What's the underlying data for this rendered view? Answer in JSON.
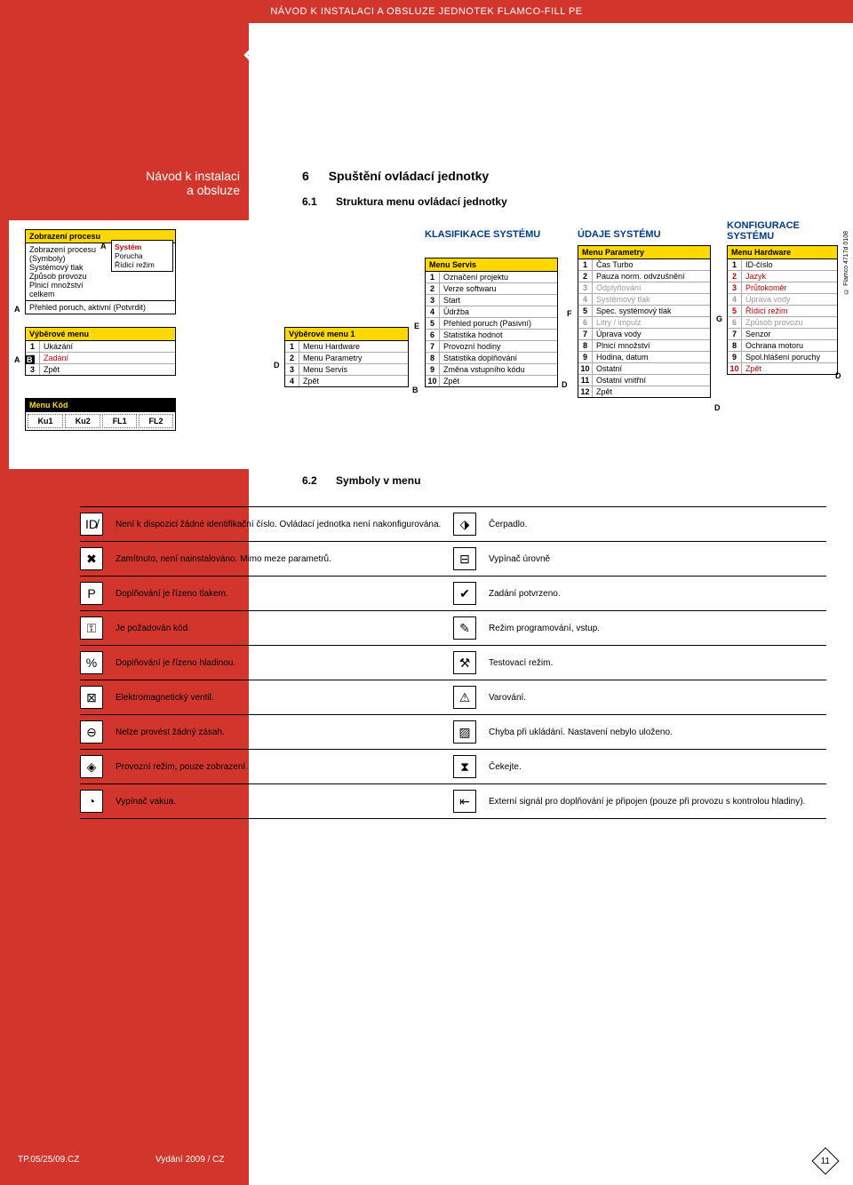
{
  "header": {
    "topbar": "NÁVOD K INSTALACI A OBSLUZE JEDNOTEK FLAMCO-FILL PE",
    "brand": "Flamco"
  },
  "nav": {
    "line1": "Návod k instalaci",
    "line2": "a obsluze"
  },
  "section6": {
    "num": "6",
    "title": "Spuštění ovládací jednotky"
  },
  "section61": {
    "num": "6.1",
    "title": "Struktura menu ovládací jednotky"
  },
  "section62": {
    "num": "6.2",
    "title": "Symboly v menu"
  },
  "diagram": {
    "zobrazeni": {
      "title": "Zobrazení procesu",
      "lines": [
        "Zobrazení procesu",
        "(Symboly)",
        "Systémový tlak",
        "Způsob provozu",
        "Plnicí množství",
        "celkem"
      ],
      "alert": "Přehled poruch, aktivní (Potvrdit)",
      "sysbox_a": "A",
      "sysbox_title": "Systém",
      "sysbox_l1": "Porucha",
      "sysbox_l2": "Řídicí režim"
    },
    "vyber_main": {
      "title": "Výběrové menu",
      "items": [
        {
          "n": "1",
          "t": "Ukázání"
        },
        {
          "n": "2",
          "t": "Zadání",
          "cls": "red"
        },
        {
          "n": "3",
          "t": "Zpět"
        }
      ],
      "tagA": "A",
      "tagB": "B"
    },
    "vyber_1": {
      "title": "Výběrové menu 1",
      "items": [
        {
          "n": "1",
          "t": "Menu Hardware"
        },
        {
          "n": "2",
          "t": "Menu Parametry"
        },
        {
          "n": "3",
          "t": "Menu Servis"
        },
        {
          "n": "4",
          "t": "Zpět"
        }
      ],
      "tagD": "D",
      "tagB": "B"
    },
    "kod": {
      "title": "Menu Kód",
      "cells": [
        "Ku1",
        "Ku2",
        "FL1",
        "FL2"
      ]
    },
    "klas_label": "KLASIFIKACE SYSTÉMU",
    "servis": {
      "title": "Menu Servis",
      "items": [
        {
          "n": "1",
          "t": "Označení projektu"
        },
        {
          "n": "2",
          "t": "Verze softwaru"
        },
        {
          "n": "3",
          "t": "Start"
        },
        {
          "n": "4",
          "t": "Údržba"
        },
        {
          "n": "5",
          "t": "Přehled poruch (Pasivní)"
        },
        {
          "n": "6",
          "t": "Statistika hodnot"
        },
        {
          "n": "7",
          "t": "Provozní hodiny"
        },
        {
          "n": "8",
          "t": "Statistika doplňování"
        },
        {
          "n": "9",
          "t": "Změna vstupního kódu"
        },
        {
          "n": "10",
          "t": "Zpět"
        }
      ],
      "tagE": "E",
      "tagD": "D"
    },
    "udaje_label": "ÚDAJE SYSTÉMU",
    "param": {
      "title": "Menu Parametry",
      "items": [
        {
          "n": "1",
          "t": "Čas Turbo"
        },
        {
          "n": "2",
          "t": "Pauza norm. odvzušnění"
        },
        {
          "n": "3",
          "t": "Odplyňování",
          "cls": "gray"
        },
        {
          "n": "4",
          "t": "Systémový tlak",
          "cls": "gray"
        },
        {
          "n": "5",
          "t": "Spec. systémový tlak"
        },
        {
          "n": "6",
          "t": "Litry / impulz",
          "cls": "gray"
        },
        {
          "n": "7",
          "t": "Úprava vody"
        },
        {
          "n": "8",
          "t": "Plnicí množství"
        },
        {
          "n": "9",
          "t": "Hodina, datum"
        },
        {
          "n": "10",
          "t": "Ostatní"
        },
        {
          "n": "11",
          "t": "Ostatní vnitřní"
        },
        {
          "n": "12",
          "t": "Zpět"
        }
      ],
      "tagF": "F",
      "tagD": "D"
    },
    "konf_label": "KONFIGURACE SYSTÉMU",
    "hardware": {
      "title": "Menu Hardware",
      "items": [
        {
          "n": "1",
          "t": "ID-číslo"
        },
        {
          "n": "2",
          "t": "Jazyk",
          "cls": "red"
        },
        {
          "n": "3",
          "t": "Průtokoměr",
          "cls": "red"
        },
        {
          "n": "4",
          "t": "Úprava vody",
          "cls": "gray"
        },
        {
          "n": "5",
          "t": "Řídicí režim",
          "cls": "red"
        },
        {
          "n": "6",
          "t": "Způsob provozu",
          "cls": "gray"
        },
        {
          "n": "7",
          "t": "Senzor"
        },
        {
          "n": "8",
          "t": "Ochrana motoru"
        },
        {
          "n": "9",
          "t": "Spol.hlášení poruchy"
        },
        {
          "n": "10",
          "t": "Zpět",
          "cls": "red"
        }
      ],
      "tagG": "G",
      "tagD": "D"
    }
  },
  "legend": [
    {
      "li": "ID̸",
      "lt": "Není k dispozici žádné identifikační číslo. Ovládací jednotka není nakonfigurována.",
      "ri": "⬗",
      "rt": "Čerpadlo."
    },
    {
      "li": "✖",
      "lt": "Zamítnuto, není nainstalováno. Mimo meze parametrů.",
      "ri": "⊟",
      "rt": "Vypínač úrovně"
    },
    {
      "li": "P",
      "lt": "Doplňování je řízeno tlakem.",
      "ri": "✔",
      "rt": "Zadání potvrzeno."
    },
    {
      "li": "⚿",
      "lt": "Je požadován kód.",
      "ri": "✎",
      "rt": "Režim programování, vstup."
    },
    {
      "li": "%",
      "lt": "Doplňování je řízeno hladinou.",
      "ri": "⚒",
      "rt": "Testovací režim."
    },
    {
      "li": "⊠",
      "lt": "Elektromagnetický ventil.",
      "ri": "⚠",
      "rt": "Varování."
    },
    {
      "li": "⊖",
      "lt": "Nelze provést žádný zásah.",
      "ri": "▨",
      "rt": "Chyba při ukládání. Nastavení nebylo uloženo."
    },
    {
      "li": "◈",
      "lt": "Provozní režim, pouze zobrazení.",
      "ri": "⧗",
      "rt": "Čekejte."
    },
    {
      "li": "◔",
      "lt": "Vypínač vakua.",
      "ri": "⇤",
      "rt": "Externí signál pro doplňování je připojen (pouze při provozu s kontrolou hladiny)."
    }
  ],
  "footer": {
    "left": "TP.05/25/09.CZ",
    "mid": "Vydání 2009 / CZ",
    "page": "11"
  },
  "sideCopy": "© Flamco 4717d 0108"
}
